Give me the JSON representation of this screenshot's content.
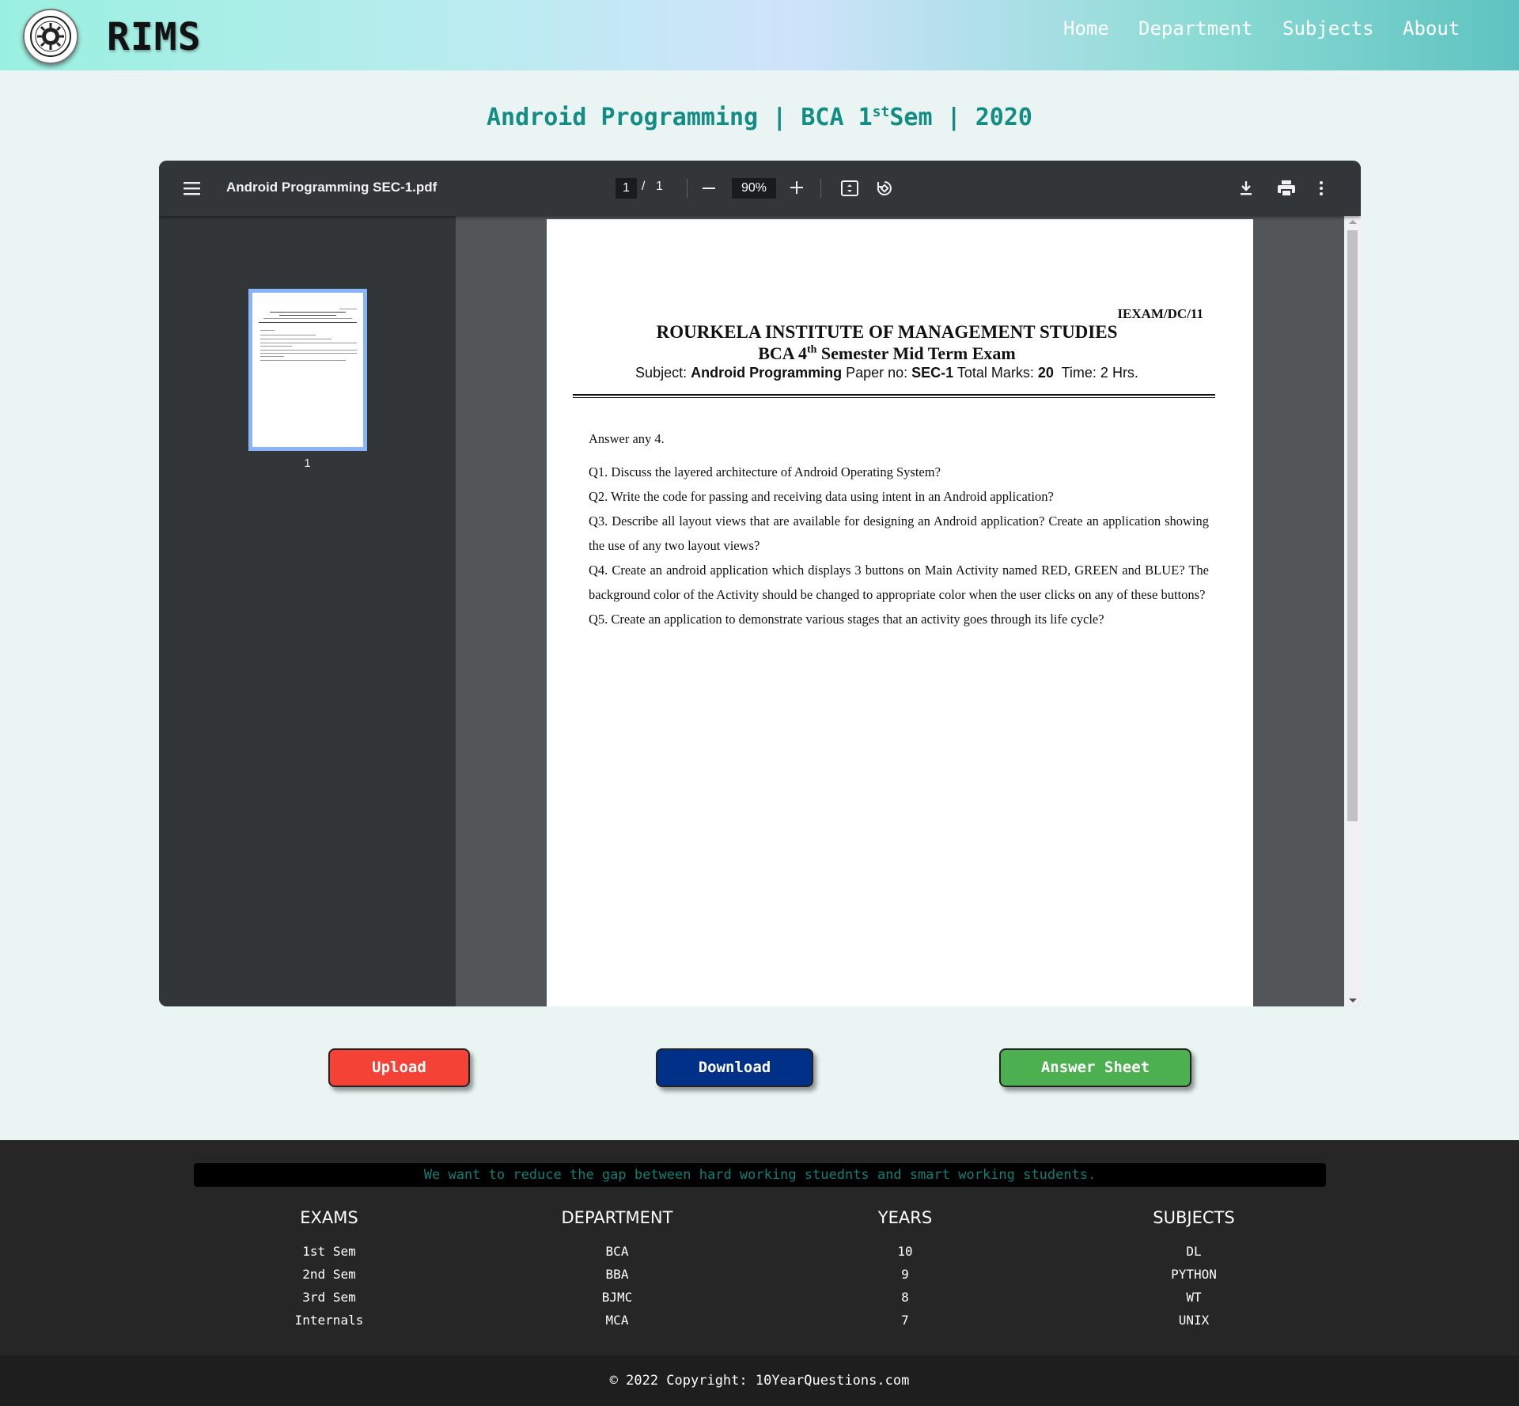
{
  "navbar": {
    "brand": "RIMS",
    "links": {
      "home": "Home",
      "department": "Department",
      "subjects": "Subjects",
      "about": "About"
    }
  },
  "page": {
    "title_main": "Android Programming | BCA 1",
    "title_sup": "st",
    "title_tail": "Sem | 2020"
  },
  "viewer": {
    "filename": "Android Programming SEC-1.pdf",
    "current_page": "1",
    "page_sep": "/",
    "total_pages": "1",
    "zoom": "90%",
    "thumbnail_label": "1",
    "document": {
      "code": "IEXAM/DC/11",
      "institute": "ROURKELA INSTITUTE OF MANAGEMENT STUDIES",
      "exam_pre": "BCA 4",
      "exam_sup": "th",
      "exam_post": " Semester Mid Term Exam",
      "subject_label": "Subject: ",
      "subject_value": "Android Programming",
      "paper_label": " Paper no: ",
      "paper_value": "SEC-1",
      "marks_label": " Total Marks: ",
      "marks_value": "20",
      "time_text": "  Time: 2 Hrs.",
      "intro": "Answer any 4.",
      "questions": [
        "Q1. Discuss the layered architecture of Android Operating System?",
        "Q2. Write the code for passing and receiving data using intent in an Android application?",
        "Q3. Describe all layout views that are available for designing an Android application? Create an application showing the use of any two layout views?",
        "Q4. Create an android application which displays 3 buttons on Main Activity named RED, GREEN and BLUE?  The background color of the Activity should be changed to appropriate color when the user clicks on any of these buttons?",
        "Q5. Create an application to demonstrate various stages that an activity goes through its life cycle?"
      ]
    }
  },
  "actions": {
    "upload": "Upload",
    "download": "Download",
    "answer_sheet": "Answer Sheet"
  },
  "footer": {
    "tagline": "We want to reduce the gap between hard working stuednts and smart working students.",
    "columns": [
      {
        "heading": "EXAMS",
        "items": [
          "1st Sem",
          "2nd Sem",
          "3rd Sem",
          "Internals"
        ]
      },
      {
        "heading": "DEPARTMENT",
        "items": [
          "BCA",
          "BBA",
          "BJMC",
          "MCA"
        ]
      },
      {
        "heading": "YEARS",
        "items": [
          "10",
          "9",
          "8",
          "7"
        ]
      },
      {
        "heading": "SUBJECTS",
        "items": [
          "DL",
          "PYTHON",
          "WT",
          "UNIX"
        ]
      }
    ],
    "copyright": "© 2022 Copyright: 10YearQuestions.com"
  },
  "colors": {
    "title": "#138d83",
    "upload": "#f44336",
    "download": "#003087",
    "answer_sheet": "#4caf50",
    "viewer_toolbar": "#323639",
    "footer_bg": "#262626"
  },
  "icons": [
    "logo-emblem-icon",
    "menu-icon",
    "zoom-out-icon",
    "zoom-in-icon",
    "fit-page-icon",
    "rotate-icon",
    "download-icon",
    "print-icon",
    "more-vert-icon"
  ]
}
